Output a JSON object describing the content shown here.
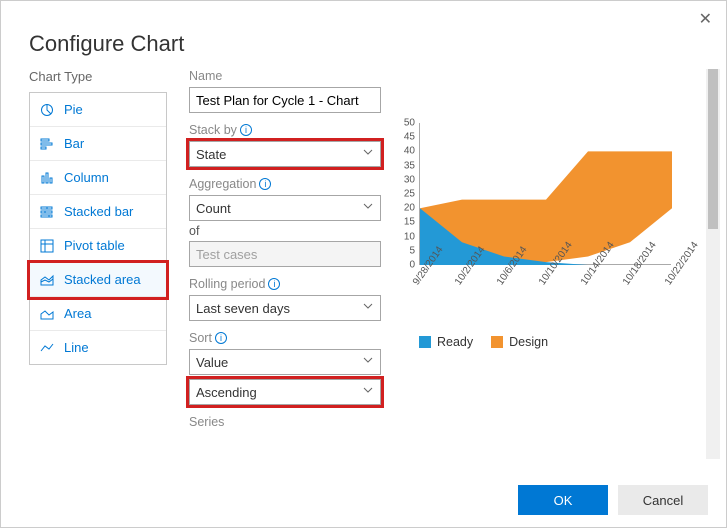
{
  "dialog": {
    "title": "Configure Chart",
    "chartTypeHeading": "Chart Type"
  },
  "chartTypes": [
    {
      "id": "pie",
      "label": "Pie"
    },
    {
      "id": "bar",
      "label": "Bar"
    },
    {
      "id": "column",
      "label": "Column"
    },
    {
      "id": "stackedbar",
      "label": "Stacked bar"
    },
    {
      "id": "pivot",
      "label": "Pivot table"
    },
    {
      "id": "stackedarea",
      "label": "Stacked area",
      "selected": true
    },
    {
      "id": "area",
      "label": "Area"
    },
    {
      "id": "line",
      "label": "Line"
    }
  ],
  "config": {
    "nameLabel": "Name",
    "nameValue": "Test Plan for Cycle 1 - Chart",
    "stackByLabel": "Stack by",
    "stackByValue": "State",
    "aggregationLabel": "Aggregation",
    "aggregationValue": "Count",
    "ofLabel": "of",
    "ofValue": "Test cases",
    "rollingLabel": "Rolling period",
    "rollingValue": "Last seven days",
    "sortLabel": "Sort",
    "sortFieldValue": "Value",
    "sortDirValue": "Ascending",
    "seriesLabel": "Series"
  },
  "legend": {
    "s1": "Ready",
    "s2": "Design"
  },
  "buttons": {
    "ok": "OK",
    "cancel": "Cancel"
  },
  "chart_data": {
    "type": "area",
    "stacked": true,
    "x": [
      "9/28/2014",
      "10/2/2014",
      "10/6/2014",
      "10/10/2014",
      "10/14/2014",
      "10/18/2014",
      "10/22/2014"
    ],
    "series": [
      {
        "name": "Ready",
        "color": "#2399d6",
        "values": [
          20,
          8,
          3,
          1,
          0,
          0,
          0
        ]
      },
      {
        "name": "Design",
        "color": "#f2932f",
        "values": [
          0,
          15,
          20,
          22,
          40,
          40,
          40
        ]
      }
    ],
    "ylim": [
      0,
      50
    ],
    "yticks": [
      0,
      5,
      10,
      15,
      20,
      25,
      30,
      35,
      40,
      45,
      50
    ],
    "xlabel": "",
    "ylabel": "",
    "title": ""
  }
}
